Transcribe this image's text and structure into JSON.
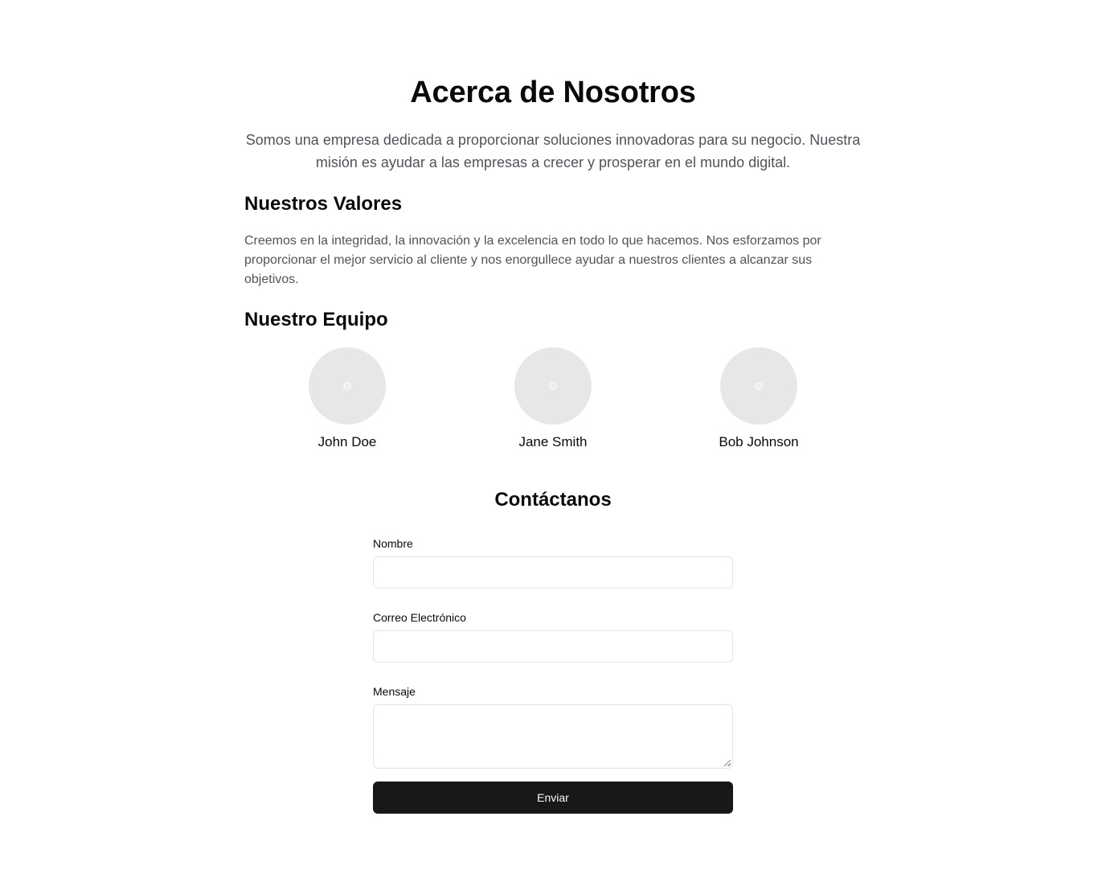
{
  "hero": {
    "title": "Acerca de Nosotros",
    "text": "Somos una empresa dedicada a proporcionar soluciones innovadoras para su negocio. Nuestra misión es ayudar a las empresas a crecer y prosperar en el mundo digital."
  },
  "values": {
    "title": "Nuestros Valores",
    "text": "Creemos en la integridad, la innovación y la excelencia en todo lo que hacemos. Nos esforzamos por proporcionar el mejor servicio al cliente y nos enorgullece ayudar a nuestros clientes a alcanzar sus objetivos."
  },
  "team": {
    "title": "Nuestro Equipo",
    "members": [
      {
        "name": "John Doe",
        "avatar_icon": "avatar-placeholder-icon"
      },
      {
        "name": "Jane Smith",
        "avatar_icon": "avatar-placeholder-icon"
      },
      {
        "name": "Bob Johnson",
        "avatar_icon": "avatar-placeholder-icon"
      }
    ]
  },
  "contact": {
    "title": "Contáctanos",
    "name_label": "Nombre",
    "name_value": "",
    "email_label": "Correo Electrónico",
    "email_value": "",
    "message_label": "Mensaje",
    "message_value": "",
    "submit_label": "Enviar"
  },
  "colors": {
    "button_bg": "#18181b",
    "muted_text": "#52525b",
    "avatar_bg": "#e7e7e7",
    "input_border": "#e4e4e7"
  }
}
